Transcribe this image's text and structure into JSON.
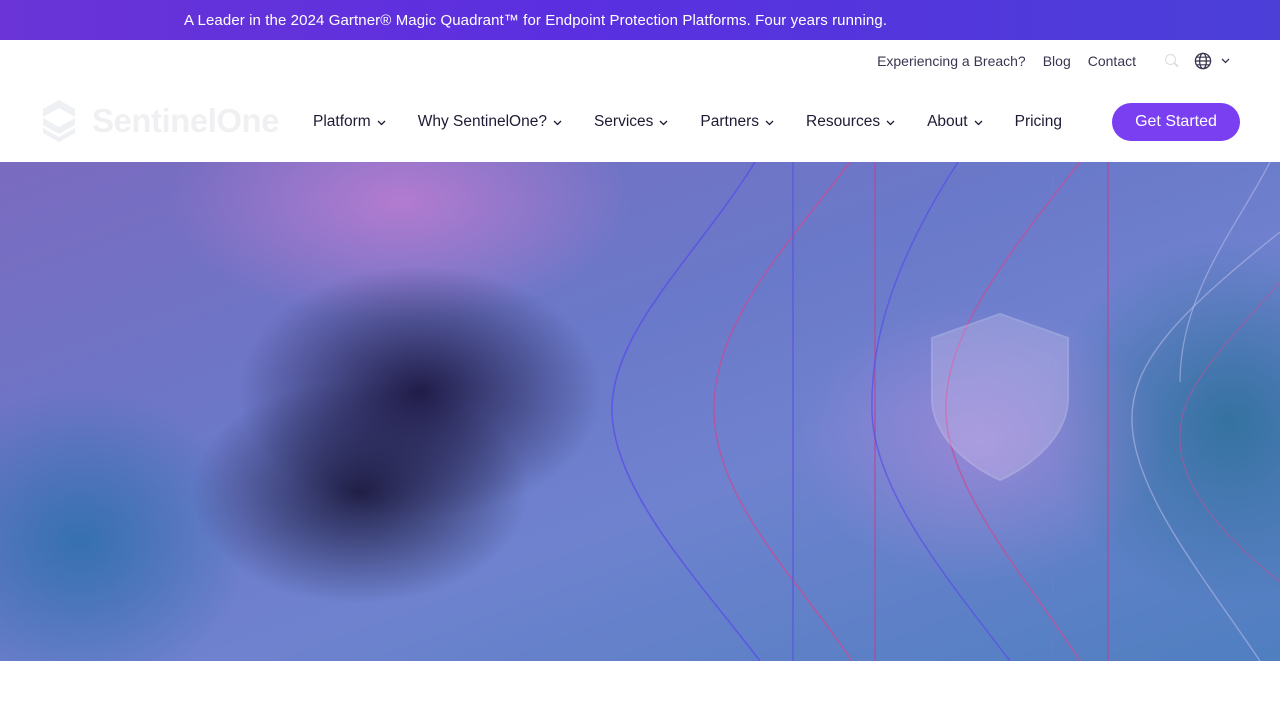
{
  "announcement": {
    "text": "A Leader in the 2024 Gartner® Magic Quadrant™ for Endpoint Protection Platforms. Four years running."
  },
  "utility_nav": {
    "links": [
      "Experiencing a Breach?",
      "Blog",
      "Contact"
    ],
    "icons": [
      "search-icon",
      "globe-icon",
      "chevron-down-icon"
    ]
  },
  "brand": {
    "name": "SentinelOne",
    "logo_icon": "sentinelone-logo-icon"
  },
  "main_nav": {
    "items": [
      {
        "label": "Platform",
        "has_dropdown": true
      },
      {
        "label": "Why SentinelOne?",
        "has_dropdown": true
      },
      {
        "label": "Services",
        "has_dropdown": true
      },
      {
        "label": "Partners",
        "has_dropdown": true
      },
      {
        "label": "Resources",
        "has_dropdown": true
      },
      {
        "label": "About",
        "has_dropdown": true
      },
      {
        "label": "Pricing",
        "has_dropdown": false
      }
    ],
    "cta_label": "Get Started"
  },
  "hero": {
    "decoration_icon": "shield-icon"
  },
  "colors": {
    "banner_purple": "#5a2fe0",
    "cta_purple": "#7b3ff2",
    "nav_text": "#1f1a33"
  }
}
